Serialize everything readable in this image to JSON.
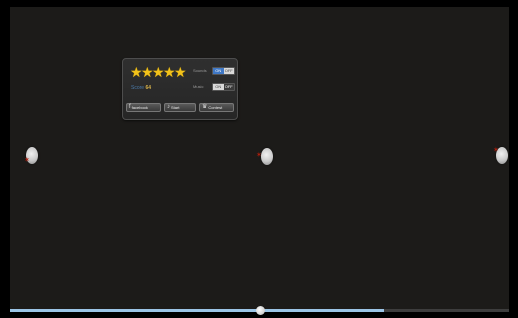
{
  "hud": {
    "rating": {
      "filled": 5,
      "max": 5,
      "star_char": "★"
    },
    "score_label": "Score",
    "score_value": "64",
    "settings": [
      {
        "label": "Sounds",
        "on": "ON",
        "off": "OFF",
        "state": "on"
      },
      {
        "label": "Music",
        "on": "ON",
        "off": "OFF",
        "state": "off"
      }
    ],
    "buttons": [
      {
        "label": "facebook",
        "icon": "facebook-icon",
        "glyph": "f"
      },
      {
        "label": "Start",
        "icon": "play-icon",
        "glyph": "♪"
      },
      {
        "label": "Contest",
        "icon": "trophy-icon",
        "glyph": "♛"
      }
    ]
  },
  "markers": [
    {
      "name": "left-marker",
      "icon": "pin-icon",
      "pin_glyph": "✶"
    },
    {
      "name": "center-marker",
      "icon": "pin-icon",
      "pin_glyph": "✶"
    },
    {
      "name": "right-marker",
      "icon": "pin-icon",
      "pin_glyph": "✶"
    }
  ],
  "playback": {
    "progress": 0.75,
    "thumb_position": 0.5
  },
  "colors": {
    "stage": "#1c1b19",
    "star": "#f2c21a",
    "toggle_on": "#3f78c6",
    "progress": "#9cc5e6",
    "pin": "#b41e0c"
  }
}
